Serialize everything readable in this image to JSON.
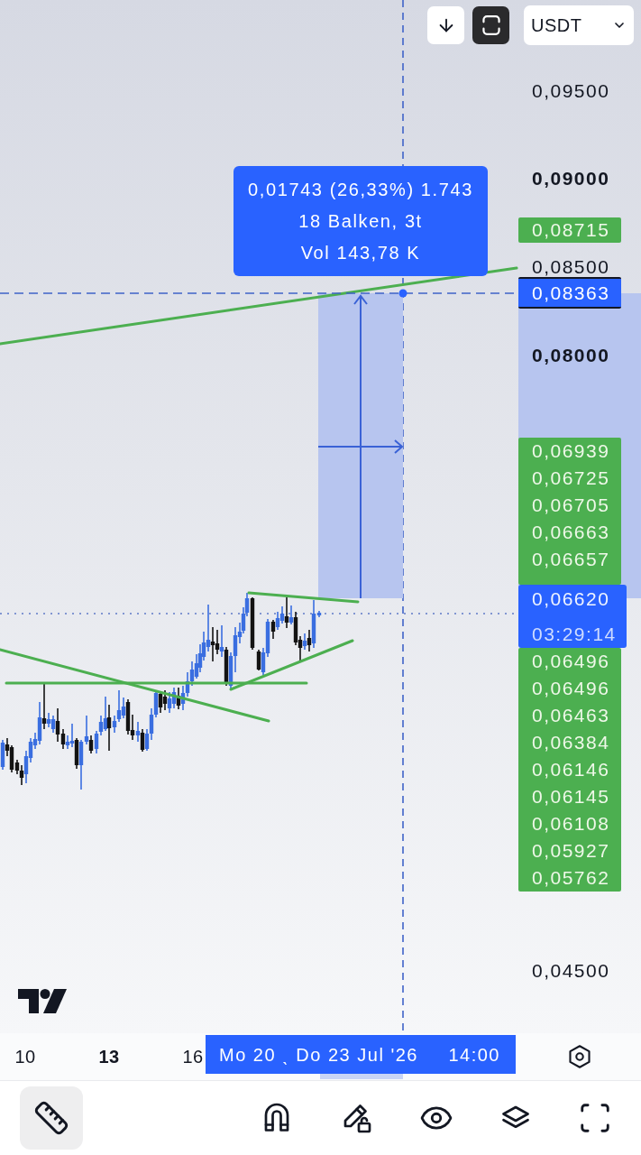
{
  "top_controls": {
    "buttons": [
      {
        "kind": "arrow-down",
        "selected": false
      },
      {
        "kind": "frame",
        "selected": true
      }
    ],
    "currency_select": {
      "value": "USDT"
    }
  },
  "measure_tooltip": {
    "lines": [
      "0,01743 (26,33%) 1.743",
      "18 Balken, 3t",
      "Vol 143,78 K"
    ]
  },
  "price_axis": {
    "ticks": [
      {
        "label": "0,09500",
        "bold": false
      },
      {
        "label": "0,09000",
        "bold": true
      },
      {
        "label": "0,08500",
        "bold": false
      },
      {
        "label": "0,08000",
        "bold": true
      },
      {
        "label": "0,04500",
        "bold": false
      }
    ],
    "badges": [
      {
        "kind": "alert",
        "label": "0,08715",
        "color": "#4caf50"
      },
      {
        "kind": "crosshair",
        "label": "0,08363",
        "color": "#2962ff"
      }
    ],
    "upper_stack": [
      "0,06939",
      "0,06725",
      "0,06705",
      "0,06663",
      "0,06657"
    ],
    "last_price": {
      "price": "0,06620",
      "countdown": "03:29:14"
    },
    "lower_stack": [
      "0,06496",
      "0,06496",
      "0,06463",
      "0,06384",
      "0,06146",
      "0,06145",
      "0,06108",
      "0,05927",
      "0,05762"
    ]
  },
  "time_axis": {
    "ticks": [
      {
        "label": "10",
        "bold": false
      },
      {
        "label": "13",
        "bold": true
      },
      {
        "label": "16",
        "bold": false
      }
    ],
    "range_label": {
      "range": "Mo 20 ˎ Do 23 Jul '26",
      "time": "14:00"
    }
  },
  "bottom_toolbar": {
    "tools": [
      {
        "kind": "ruler",
        "selected": true
      },
      {
        "kind": "magnet",
        "selected": false
      },
      {
        "kind": "pencil-lock",
        "selected": false
      },
      {
        "kind": "eye",
        "selected": false
      },
      {
        "kind": "layers",
        "selected": false
      },
      {
        "kind": "corners",
        "selected": false
      }
    ]
  }
}
